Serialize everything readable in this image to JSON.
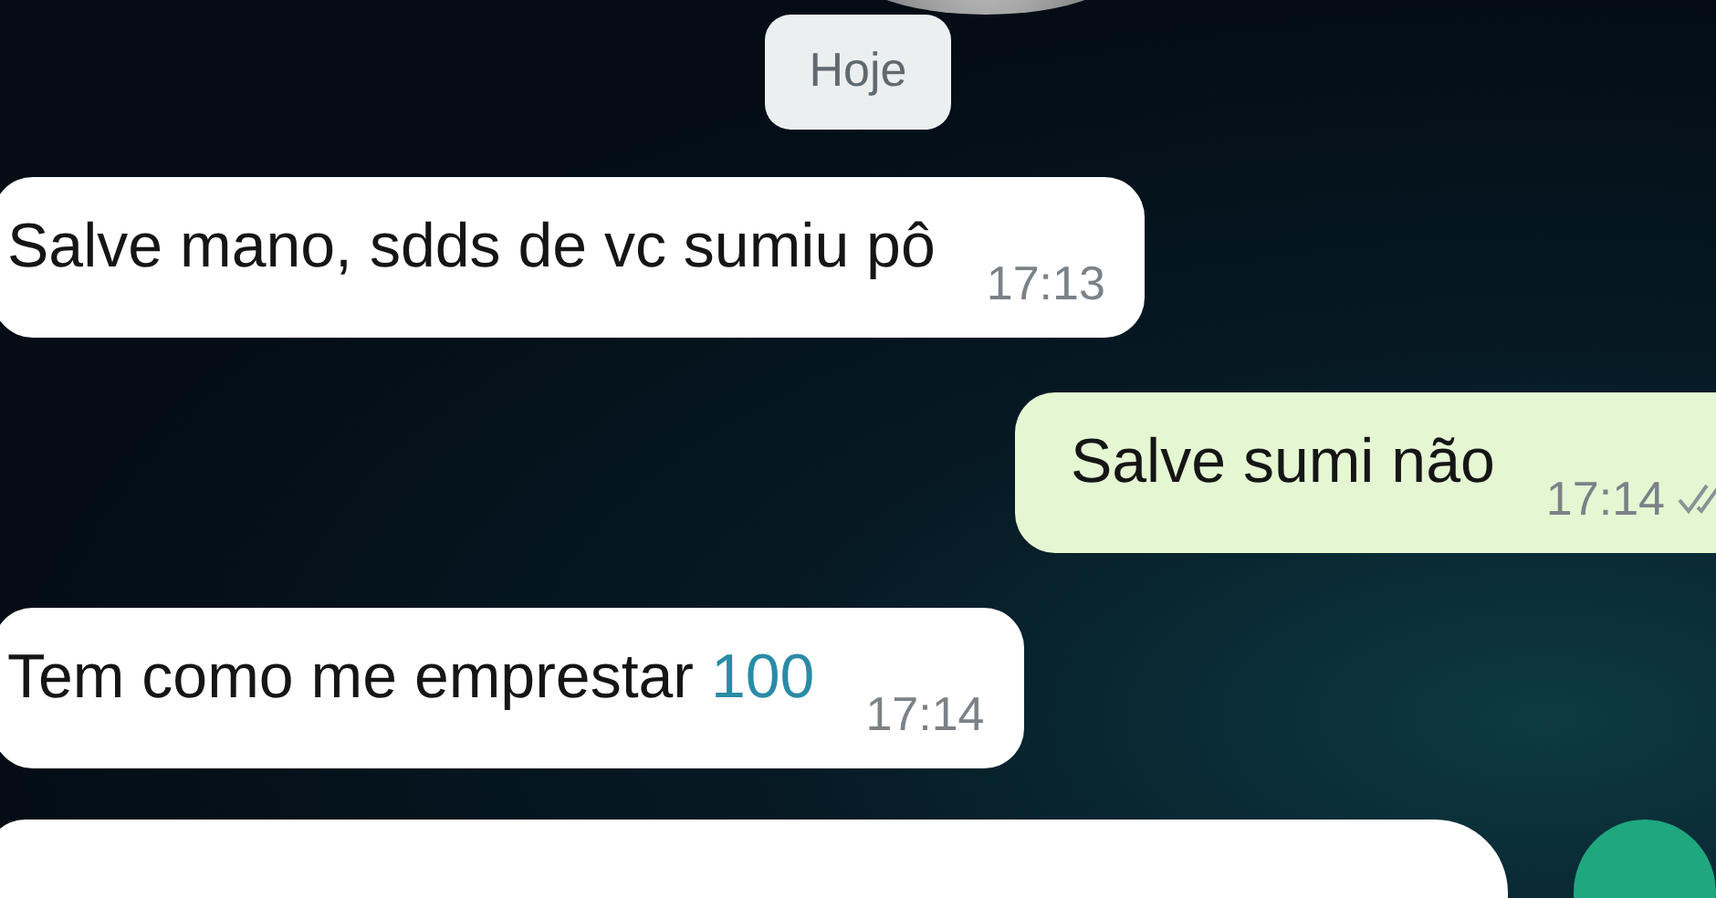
{
  "date_chip": "Hoje",
  "messages": [
    {
      "kind": "incoming",
      "text": "Salve mano, sdds de vc sumiu pô",
      "time": "17:13"
    },
    {
      "kind": "outgoing",
      "text": "Salve sumi não",
      "time": "17:14",
      "read": false
    },
    {
      "kind": "incoming",
      "text": "Tem como me emprestar",
      "link": "100",
      "time": "17:14"
    }
  ]
}
